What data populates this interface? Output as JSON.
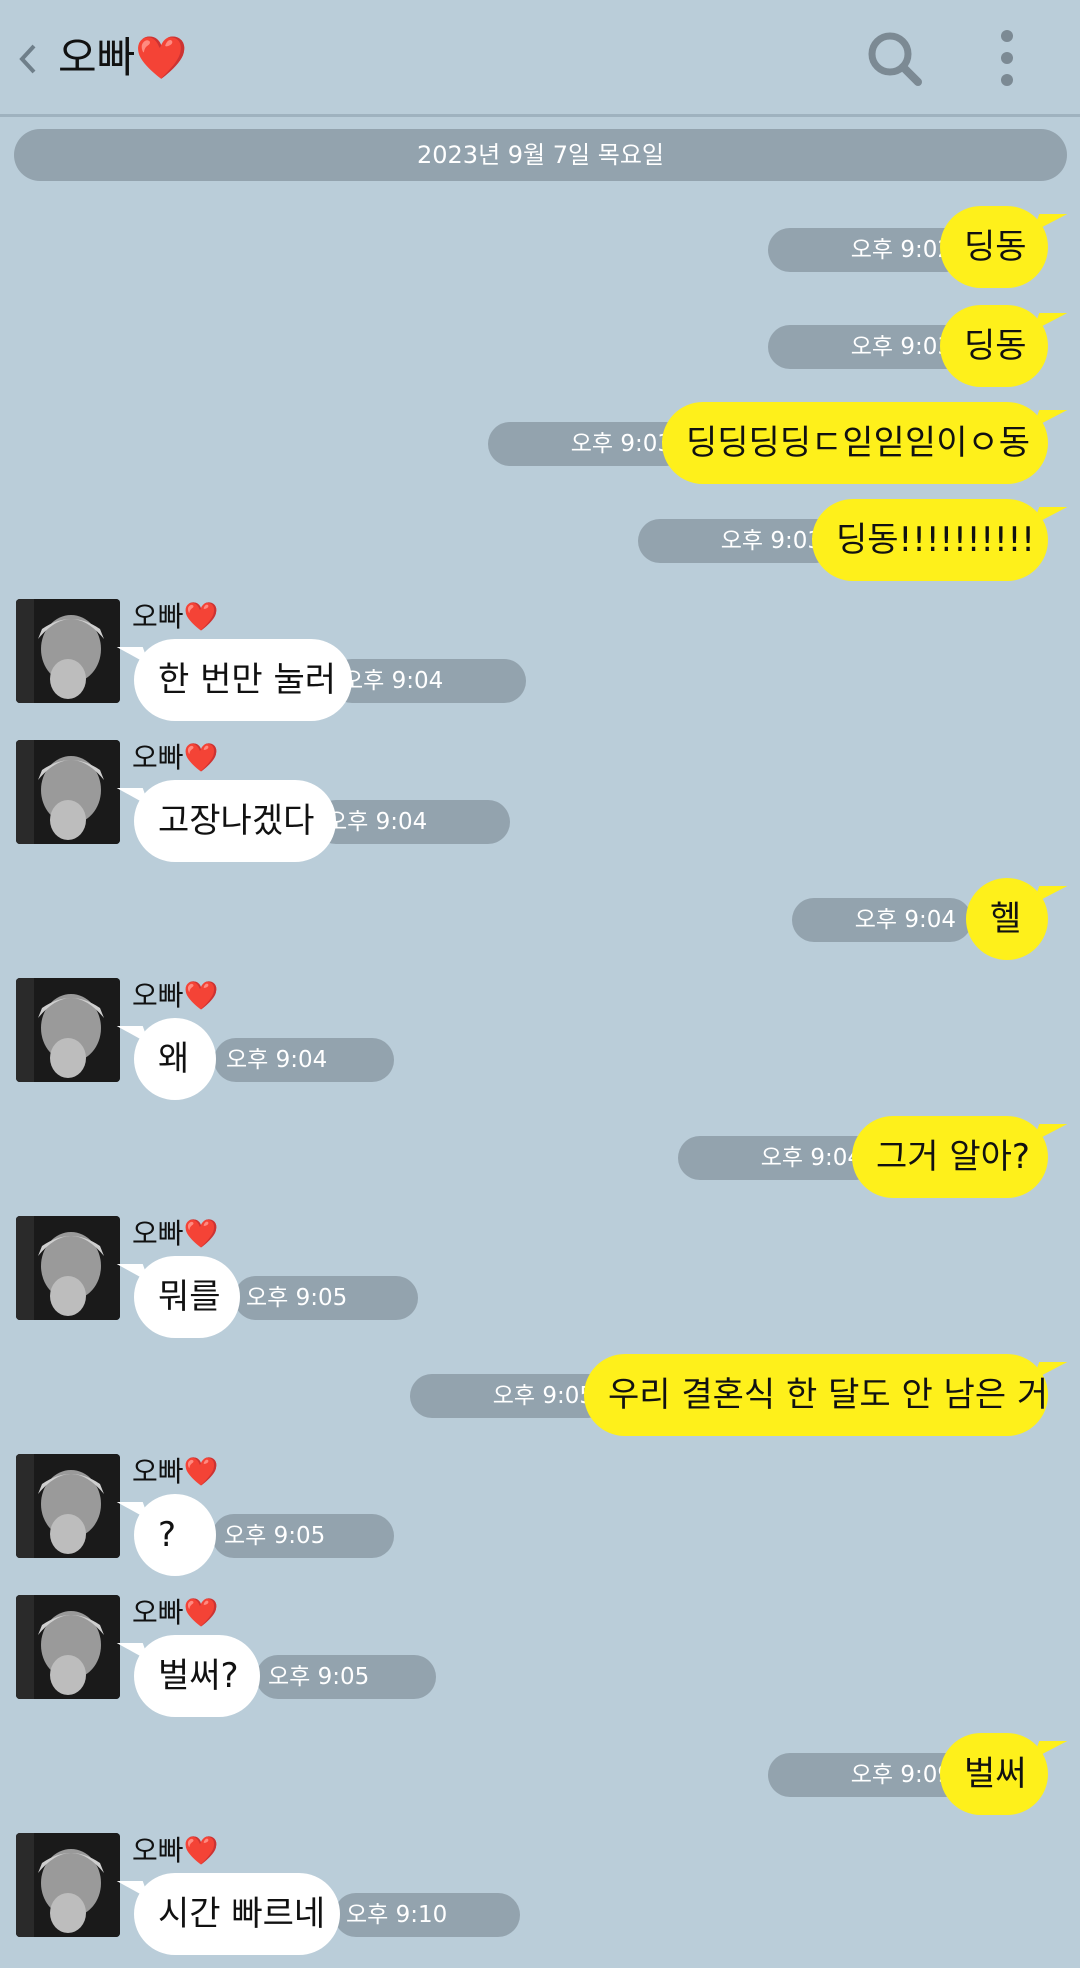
{
  "header": {
    "title": "오빠❤️"
  },
  "date_divider": "2023년 9월 7일 목요일",
  "messages": [
    {
      "from": "me",
      "text": "딩동",
      "time": "오후 9:02"
    },
    {
      "from": "me",
      "text": "딩동",
      "time": "오후 9:03"
    },
    {
      "from": "me",
      "text": "딩딩딩딩ㄷ읻읻읻이ㅇ동",
      "time": "오후 9:03"
    },
    {
      "from": "me",
      "text": "딩동!!!!!!!!!!",
      "time": "오후 9:03"
    },
    {
      "from": "them",
      "name": "오빠❤️",
      "text": "한 번만 눌러",
      "time": "오후 9:04"
    },
    {
      "from": "them",
      "name": "오빠❤️",
      "text": "고장나겠다",
      "time": "오후 9:04"
    },
    {
      "from": "me",
      "text": "헬",
      "time": "오후 9:04"
    },
    {
      "from": "them",
      "name": "오빠❤️",
      "text": "왜",
      "time": "오후 9:04"
    },
    {
      "from": "me",
      "text": "그거 알아?",
      "time": "오후 9:04"
    },
    {
      "from": "them",
      "name": "오빠❤️",
      "text": "뭐를",
      "time": "오후 9:05"
    },
    {
      "from": "me",
      "text": "우리 결혼식 한 달도 안 남은 거",
      "time": "오후 9:05"
    },
    {
      "from": "them",
      "name": "오빠❤️",
      "text": "?",
      "time": "오후 9:05"
    },
    {
      "from": "them",
      "name": "오빠❤️",
      "text": "벌써?",
      "time": "오후 9:05"
    },
    {
      "from": "me",
      "text": "벌써",
      "time": "오후 9:09"
    },
    {
      "from": "them",
      "name": "오빠❤️",
      "text": "시간 빠르네",
      "time": "오후 9:10"
    }
  ]
}
